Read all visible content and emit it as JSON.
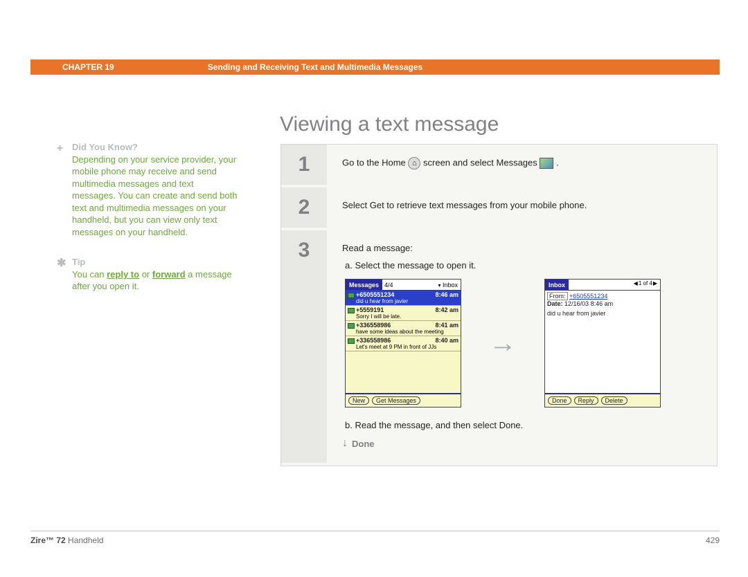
{
  "header": {
    "chapter": "CHAPTER 19",
    "title": "Sending and Receiving Text and Multimedia Messages"
  },
  "pageTitle": "Viewing a text message",
  "sidebar": {
    "didYouKnow": {
      "marker": "+",
      "label": "Did You Know?",
      "text": "Depending on your service provider, your mobile phone may receive and send multimedia messages and text messages. You can create and send both text and multimedia messages on your handheld, but you can view only text messages on your handheld."
    },
    "tip": {
      "marker": "✱",
      "label": "Tip",
      "pre": "You can ",
      "link1": "reply to",
      "mid": " or ",
      "link2": "forward",
      "post": " a message after you open it."
    }
  },
  "steps": {
    "s1": {
      "num": "1",
      "pre": "Go to the Home ",
      "mid": " screen and select Messages ",
      "post": " ."
    },
    "s2": {
      "num": "2",
      "text": "Select Get to retrieve text messages from your mobile phone."
    },
    "s3": {
      "num": "3",
      "intro": "Read a message:",
      "a": "a.  Select the message to open it.",
      "b": "b.  Read the message, and then select Done."
    }
  },
  "screen1": {
    "tab": "Messages",
    "count": "4/4",
    "inbox": "Inbox",
    "items": [
      {
        "from": "+6505551234",
        "time": "8:46 am",
        "snippet": "did u hear from javier"
      },
      {
        "from": "+5559191",
        "time": "8:42 am",
        "snippet": "Sorry I will be late."
      },
      {
        "from": "+336558986",
        "time": "8:41 am",
        "snippet": "have some ideas about the meeting"
      },
      {
        "from": "+336558986",
        "time": "8:40 am",
        "snippet": "Let's meet at 9 PM in front of JJs"
      }
    ],
    "btnNew": "New",
    "btnGet": "Get Messages"
  },
  "screen2": {
    "tab": "Inbox",
    "pager": "1 of 4",
    "fromLabel": "From:",
    "from": "+6505551234",
    "dateLabel": "Date:",
    "date": "12/16/03 8:46 am",
    "body": "did u hear from javier",
    "btnDone": "Done",
    "btnReply": "Reply",
    "btnDelete": "Delete"
  },
  "done": "Done",
  "footer": {
    "product": "Zire™ 72",
    "suffix": " Handheld",
    "page": "429"
  }
}
